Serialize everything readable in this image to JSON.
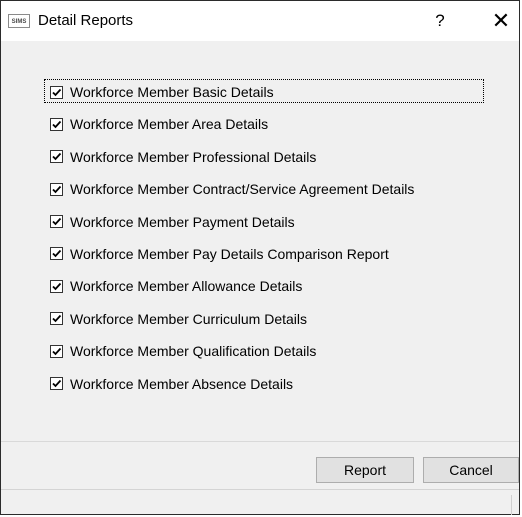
{
  "window": {
    "app_icon_text": "SIMS",
    "title": "Detail Reports",
    "help_label": "?",
    "close_label": "✕"
  },
  "reports": [
    {
      "label": "Workforce Member Basic Details",
      "checked": true
    },
    {
      "label": "Workforce Member Area Details",
      "checked": true
    },
    {
      "label": "Workforce Member Professional Details",
      "checked": true
    },
    {
      "label": "Workforce Member Contract/Service Agreement Details",
      "checked": true
    },
    {
      "label": "Workforce Member Payment Details",
      "checked": true
    },
    {
      "label": "Workforce Member Pay Details Comparison Report",
      "checked": true
    },
    {
      "label": "Workforce Member Allowance Details",
      "checked": true
    },
    {
      "label": "Workforce Member Curriculum Details",
      "checked": true
    },
    {
      "label": "Workforce Member Qualification Details",
      "checked": true
    },
    {
      "label": "Workforce Member Absence Details",
      "checked": true
    }
  ],
  "buttons": {
    "report_label": "Report",
    "cancel_label": "Cancel"
  }
}
